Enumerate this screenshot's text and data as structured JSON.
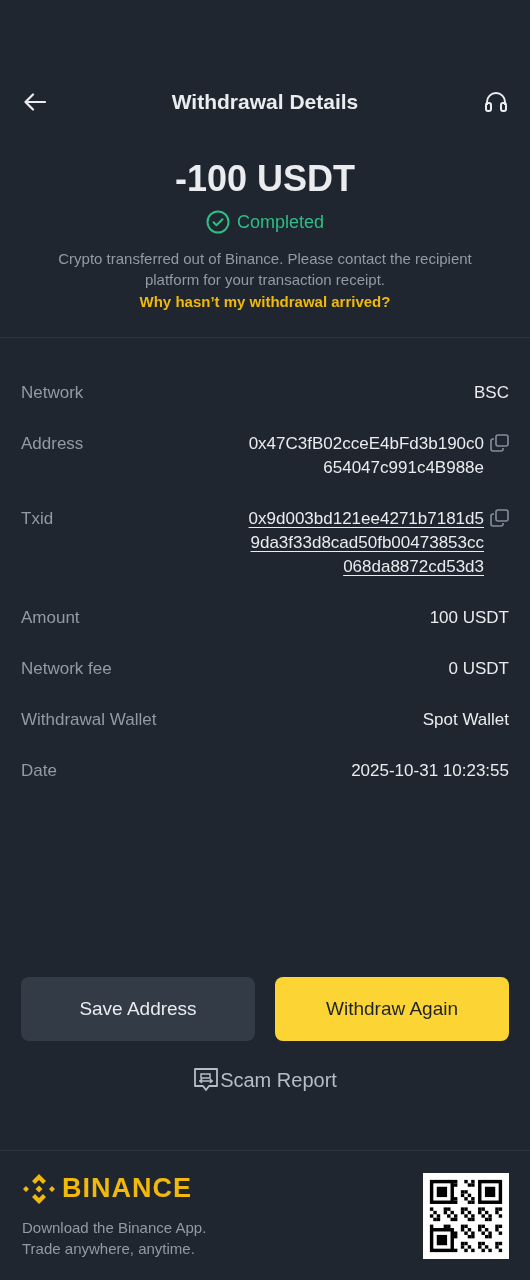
{
  "header": {
    "title": "Withdrawal Details"
  },
  "summary": {
    "amount": "-100 USDT",
    "status": "Completed",
    "completed": true,
    "description": "Crypto transferred out of Binance. Please contact the recipient platform for your transaction receipt.",
    "help_link": "Why hasn’t my withdrawal arrived?"
  },
  "details": [
    {
      "label": "Network",
      "kind": "plain",
      "value": [
        "BSC"
      ]
    },
    {
      "label": "Address",
      "kind": "copy",
      "value": [
        "0x47C3fB02cceE4bFd3b190c0",
        "654047c991c4B988e"
      ]
    },
    {
      "label": "Txid",
      "kind": "link",
      "value": [
        "0x9d003bd121ee4271b7181d5",
        "9da3f33d8cad50fb00473853cc",
        "068da8872cd53d3"
      ]
    },
    {
      "label": "Amount",
      "kind": "plain",
      "value": [
        "100 USDT"
      ]
    },
    {
      "label": "Network fee",
      "kind": "plain",
      "value": [
        "0 USDT"
      ]
    },
    {
      "label": "Withdrawal Wallet",
      "kind": "plain",
      "value": [
        "Spot Wallet"
      ]
    },
    {
      "label": "Date",
      "kind": "plain",
      "value": [
        "2025-10-31 10:23:55"
      ]
    }
  ],
  "buttons": [
    {
      "label": "Save Address",
      "kind": "secondary"
    },
    {
      "label": "Withdraw Again",
      "kind": "primary"
    }
  ],
  "scam_report": "Scam Report",
  "footer": {
    "brand": "BINANCE",
    "tagline": [
      "Download the Binance App.",
      "Trade anywhere, anytime."
    ]
  }
}
